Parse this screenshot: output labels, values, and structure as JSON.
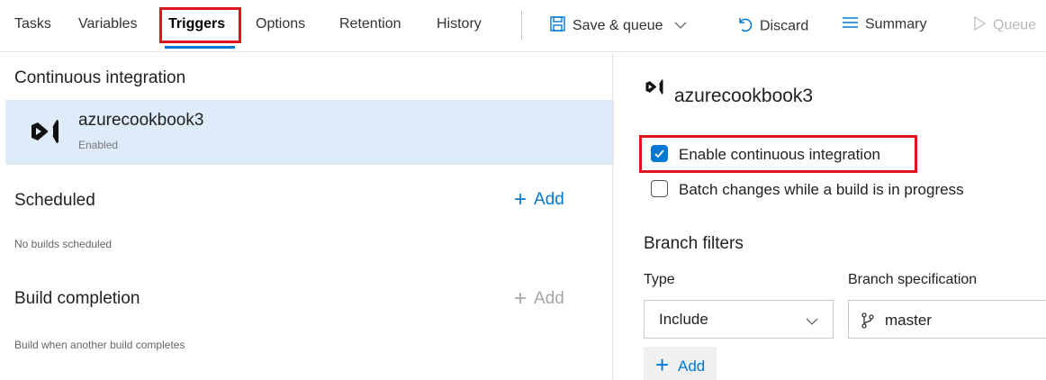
{
  "nav": {
    "tabs": [
      {
        "label": "Tasks"
      },
      {
        "label": "Variables"
      },
      {
        "label": "Triggers",
        "active": true
      },
      {
        "label": "Options"
      },
      {
        "label": "Retention"
      },
      {
        "label": "History"
      }
    ],
    "actions": {
      "save_queue": "Save & queue",
      "discard": "Discard",
      "summary": "Summary",
      "queue": "Queue"
    }
  },
  "left": {
    "ci": {
      "title": "Continuous integration",
      "repo_name": "azurecookbook3",
      "status": "Enabled"
    },
    "scheduled": {
      "title": "Scheduled",
      "add": "Add",
      "empty": "No builds scheduled"
    },
    "build_completion": {
      "title": "Build completion",
      "add": "Add",
      "description": "Build when another build completes"
    }
  },
  "right": {
    "repo_title": "azurecookbook3",
    "enable_ci": {
      "label": "Enable continuous integration",
      "checked": true
    },
    "batch_changes": {
      "label": "Batch changes while a build is in progress",
      "checked": false
    },
    "branch_filters": {
      "heading": "Branch filters",
      "type_label": "Type",
      "spec_label": "Branch specification",
      "type_value": "Include",
      "spec_value": "master",
      "add": "Add"
    }
  },
  "colors": {
    "accent": "#0078d4",
    "highlight": "#e0141e",
    "selected_bg": "#deecf9"
  }
}
